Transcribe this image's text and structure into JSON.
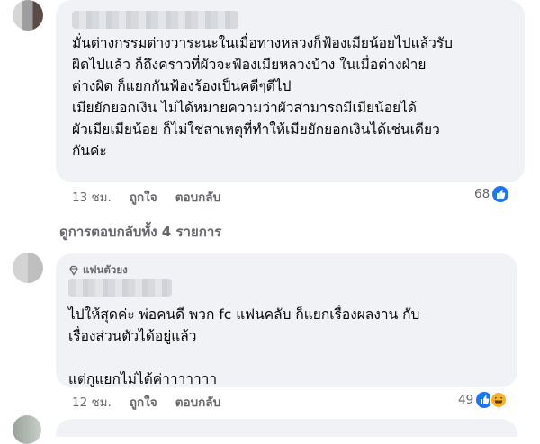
{
  "comment1": {
    "body": "มั่นต่างกรรมต่างวาระนะในเมื่อทางหลวงก็ฟ้องเมียน้อยไปแล้วรับ\nผิดไปแล้ว ก็ถึงคราวที่ผัวจะฟ้องเมียหลวงบ้าง ในเมื่อต่างฝ่าย\nต่างผิด ก็แยกกันฟ้องร้องเป็นคดีๆดีไป\nเมียยักยอกเงิน ไม่ได้หมายความว่าผัวสามารถมีเมียน้อยได้\nผัวเมียเมียน้อย ก็ไม่ใช่สาเหตุที่ทำให้เมียยักยอกเงินได้เช่นเดียว\nกันค่ะ",
    "time": "13 ชม.",
    "like_label": "ถูกใจ",
    "reply_label": "ตอบกลับ",
    "reaction_count": "68",
    "reaction_icons": [
      "like-icon"
    ],
    "like_color": "#1877f2"
  },
  "view_replies": "ดูการตอบกลับทั้ง 4 รายการ",
  "comment2": {
    "badge": "แฟนตัวยง",
    "badge_icon": "diamond-icon",
    "body": "ไปให้สุดค่ะ พ่อคนดี พวก fc แฟนคลับ ก็แยกเรื่องผลงาน กับ\nเรื่องส่วนตัวได้อยู่แล้ว\n\nแต่กูแยกไม่ได้ค่าาาาาาา",
    "time": "12 ชม.",
    "like_label": "ถูกใจ",
    "reply_label": "ตอบกลับ",
    "reaction_count": "49",
    "reaction_icons": [
      "like-icon",
      "haha-icon"
    ],
    "haha_color": "#f7b125"
  }
}
